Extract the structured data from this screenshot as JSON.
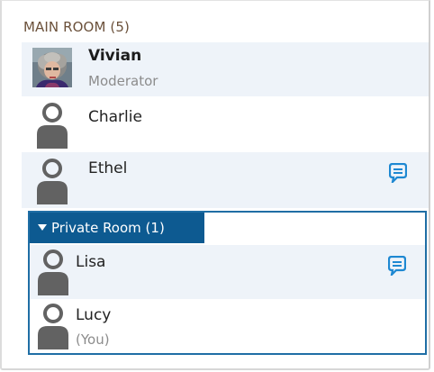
{
  "main_room": {
    "header": "MAIN ROOM (5)",
    "participants": [
      {
        "name": "Vivian",
        "role": "Moderator"
      },
      {
        "name": "Charlie"
      },
      {
        "name": "Ethel"
      }
    ]
  },
  "private_room": {
    "label": "Private Room (1)",
    "participants": [
      {
        "name": "Lisa"
      },
      {
        "name": "Lucy",
        "note": "(You)"
      }
    ]
  },
  "icons": {
    "person": "person-silhouette-icon",
    "chat": "chat-bubble-icon",
    "expand": "triangle-down-icon"
  },
  "colors": {
    "accent": "#0d5a91",
    "chat": "#1e88d2",
    "row_highlight": "#eef3f9",
    "header_text": "#6b513b"
  }
}
